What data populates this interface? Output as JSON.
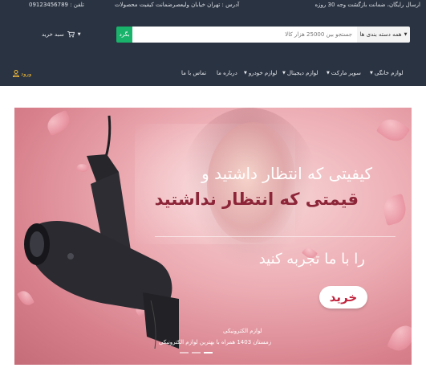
{
  "topbar": {
    "shipping": "ارسال رایگان، ضمانت بازگشت وجه 30 روزه",
    "address": "آدرس : تهران خیابان ولیعصر",
    "guarantee": "ضمانت کیفیت محصولات",
    "phone": "تلفن : 09123456789"
  },
  "search": {
    "category_label": "همه دسته بندی ها",
    "placeholder": "جستجو بین 25000 هزار کالا",
    "button_label": "بگرد"
  },
  "cart": {
    "label": "سبد خرید",
    "icon": "cart-icon"
  },
  "nav": {
    "items": [
      {
        "label": "لوازم خانگی",
        "dropdown": true
      },
      {
        "label": "سوپر مارکت",
        "dropdown": true
      },
      {
        "label": "لوازم دیجیتال",
        "dropdown": true
      },
      {
        "label": "لوازم خودرو",
        "dropdown": true
      },
      {
        "label": "درباره ما",
        "dropdown": false
      },
      {
        "label": "تماس با ما",
        "dropdown": false
      }
    ],
    "login_label": "ورود",
    "login_icon": "user-icon"
  },
  "hero": {
    "line1": "کیفیتی که انتظار داشتید و",
    "line2": "قیمتی که انتظار نداشتید",
    "line3": "را با ما تجربه کنید",
    "buy_label": "خرید",
    "caption_title": "لوازم الکترونیکی",
    "caption_text": "زمستان 1403 همراه با بهترین لوازم الکترونیکی",
    "slide_count": 3,
    "active_slide": 3
  },
  "colors": {
    "header_bg": "#2a3341",
    "accent_green": "#19b36b",
    "login_yellow": "#f0b93a",
    "hero_pink": "#e8a1ab",
    "headline_dark": "#8c2538"
  }
}
